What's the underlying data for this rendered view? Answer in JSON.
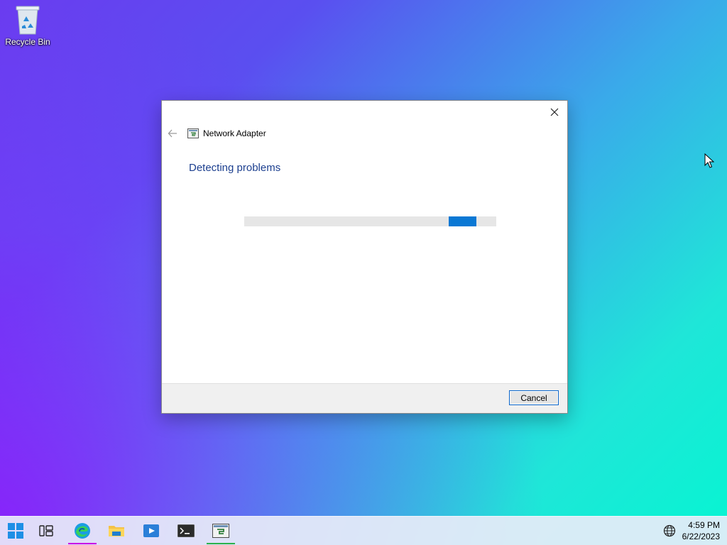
{
  "desktop": {
    "icons": [
      {
        "label": "Recycle Bin",
        "icon": "recycle-bin-icon"
      }
    ]
  },
  "dialog": {
    "title": "Network Adapter",
    "heading": "Detecting problems",
    "cancel_label": "Cancel",
    "close_icon": "close-icon",
    "back_icon": "back-arrow-icon",
    "app_icon": "troubleshooter-icon"
  },
  "taskbar": {
    "apps": [
      {
        "name": "start",
        "icon": "windows-start-icon"
      },
      {
        "name": "task-view",
        "icon": "task-view-icon"
      },
      {
        "name": "edge",
        "icon": "edge-icon"
      },
      {
        "name": "file-explorer",
        "icon": "folder-icon"
      },
      {
        "name": "media-player",
        "icon": "media-player-icon"
      },
      {
        "name": "terminal",
        "icon": "terminal-icon"
      },
      {
        "name": "troubleshooter",
        "icon": "troubleshooter-icon"
      }
    ],
    "clock": {
      "time": "4:59 PM",
      "date": "6/22/2023"
    },
    "tray_icon": "globe-icon"
  },
  "colors": {
    "accent": "#0a78d4",
    "heading": "#1c3f8f",
    "edge_indicator": "#c800e6",
    "active_indicator": "#2bb24c"
  }
}
